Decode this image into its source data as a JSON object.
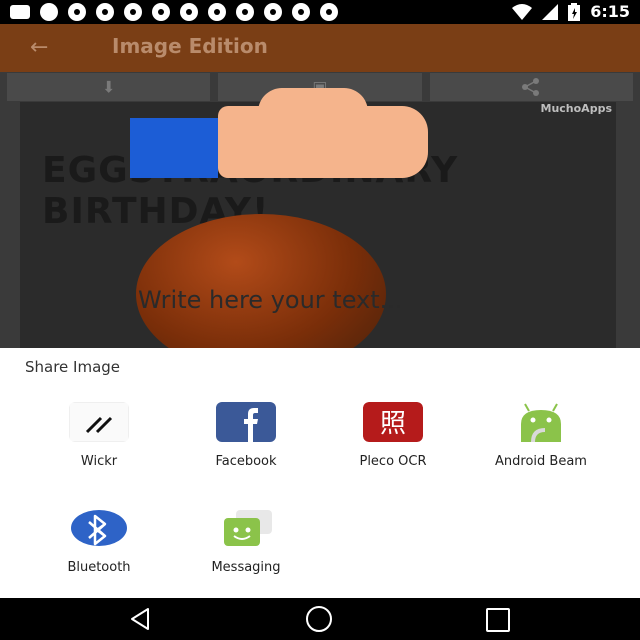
{
  "status_bar": {
    "time": "6:15"
  },
  "app_bar": {
    "title": "Image Edition"
  },
  "canvas": {
    "watermark": "MuchoApps",
    "caption": "EGGSTRAORDINARY BIRTHDAY!",
    "text_placeholder": "Write here your text..."
  },
  "share_sheet": {
    "title": "Share Image",
    "apps": [
      {
        "name": "Wickr",
        "icon": "wickr-icon"
      },
      {
        "name": "Facebook",
        "icon": "facebook-icon"
      },
      {
        "name": "Pleco OCR",
        "icon": "pleco-ocr-icon"
      },
      {
        "name": "Android Beam",
        "icon": "android-beam-icon"
      },
      {
        "name": "Bluetooth",
        "icon": "bluetooth-icon"
      },
      {
        "name": "Messaging",
        "icon": "messaging-icon"
      }
    ]
  },
  "colors": {
    "app_bar": "#7a3e15",
    "facebook_blue": "#3b5998",
    "bluetooth_blue": "#2e63c7",
    "android_green": "#8bc34a"
  }
}
